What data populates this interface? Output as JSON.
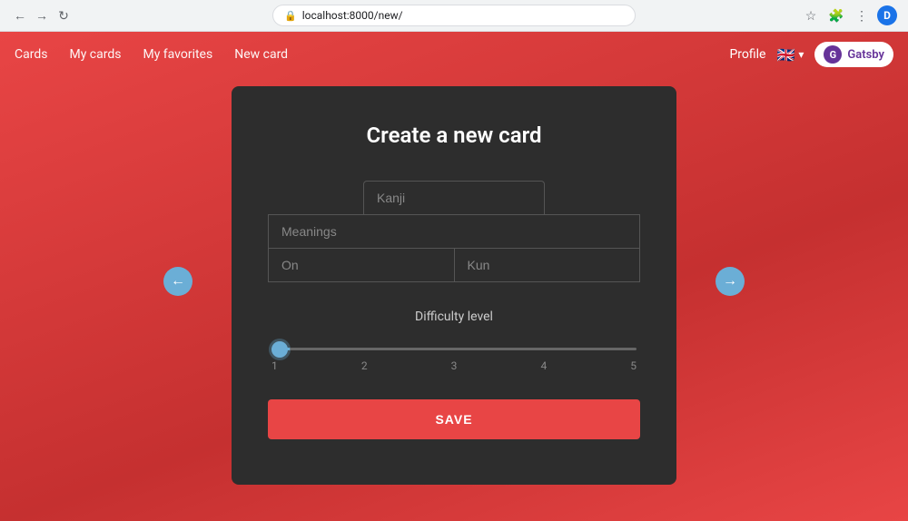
{
  "browser": {
    "url": "localhost:8000/new/",
    "profile_letter": "D"
  },
  "navbar": {
    "links": [
      {
        "label": "Cards",
        "href": "#"
      },
      {
        "label": "My cards",
        "href": "#"
      },
      {
        "label": "My favorites",
        "href": "#"
      },
      {
        "label": "New card",
        "href": "#"
      }
    ],
    "profile_label": "Profile",
    "language_code": "🇬🇧",
    "language_chevron": "▾",
    "gatsby_label": "Gatsby"
  },
  "form": {
    "title": "Create a new card",
    "kanji_placeholder": "Kanji",
    "meanings_placeholder": "Meanings",
    "on_placeholder": "On",
    "kun_placeholder": "Kun",
    "difficulty_label": "Difficulty level",
    "slider_min": "1",
    "slider_max": "5",
    "slider_labels": [
      "1",
      "2",
      "3",
      "4",
      "5"
    ],
    "slider_value": 1,
    "save_label": "SAVE"
  },
  "arrows": {
    "left_icon": "←",
    "right_icon": "→"
  }
}
